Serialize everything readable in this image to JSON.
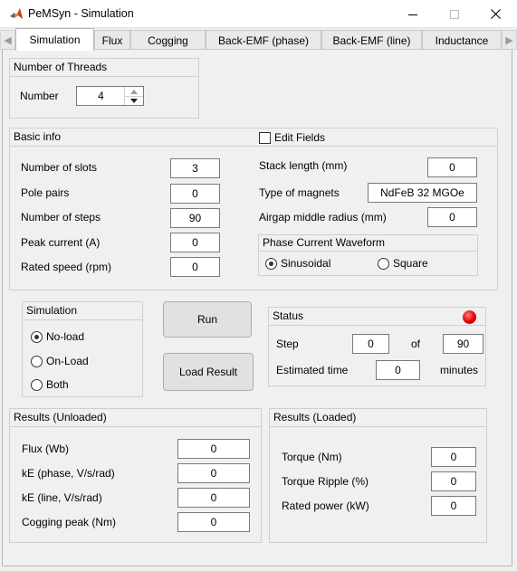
{
  "window": {
    "title": "PeMSyn - Simulation",
    "minimize_icon": "minimize-icon",
    "maximize_icon": "maximize-icon",
    "close_icon": "close-icon"
  },
  "tabs": [
    {
      "label": "Simulation",
      "active": true
    },
    {
      "label": "Flux"
    },
    {
      "label": "Cogging"
    },
    {
      "label": "Back-EMF (phase)"
    },
    {
      "label": "Back-EMF (line)"
    },
    {
      "label": "Inductance"
    }
  ],
  "threads": {
    "title": "Number of Threads",
    "label": "Number",
    "value": "4"
  },
  "basic_info": {
    "title": "Basic info",
    "edit_fields_label": "Edit Fields",
    "edit_fields_checked": false,
    "slots_label": "Number of slots",
    "slots_value": "3",
    "pole_pairs_label": "Pole pairs",
    "pole_pairs_value": "0",
    "steps_label": "Number of steps",
    "steps_value": "90",
    "peak_current_label": "Peak current (A)",
    "peak_current_value": "0",
    "rated_speed_label": "Rated speed (rpm)",
    "rated_speed_value": "0",
    "stack_length_label": "Stack length (mm)",
    "stack_length_value": "0",
    "magnets_label": "Type of magnets",
    "magnets_value": "NdFeB 32 MGOe",
    "airgap_label": "Airgap middle radius (mm)",
    "airgap_value": "0",
    "waveform": {
      "title": "Phase Current Waveform",
      "options": [
        "Sinusoidal",
        "Square"
      ],
      "selected": "Sinusoidal"
    }
  },
  "simulation": {
    "title": "Simulation",
    "options": [
      "No-load",
      "On-Load",
      "Both"
    ],
    "selected": "No-load",
    "run_label": "Run",
    "load_result_label": "Load Result"
  },
  "status": {
    "title": "Status",
    "indicator_color": "#e00000",
    "step_label": "Step",
    "step_value": "0",
    "of_label": "of",
    "total_value": "90",
    "estimated_label": "Estimated time",
    "estimated_value": "0",
    "minutes_label": "minutes"
  },
  "results_unloaded": {
    "title": "Results (Unloaded)",
    "flux_label": "Flux (Wb)",
    "flux_value": "0",
    "ke_phase_label": "kE (phase, V/s/rad)",
    "ke_phase_value": "0",
    "ke_line_label": "kE (line, V/s/rad)",
    "ke_line_value": "0",
    "cogging_label": "Cogging peak (Nm)",
    "cogging_value": "0"
  },
  "results_loaded": {
    "title": "Results (Loaded)",
    "torque_label": "Torque (Nm)",
    "torque_value": "0",
    "ripple_label": "Torque Ripple (%)",
    "ripple_value": "0",
    "power_label": "Rated power (kW)",
    "power_value": "0"
  }
}
